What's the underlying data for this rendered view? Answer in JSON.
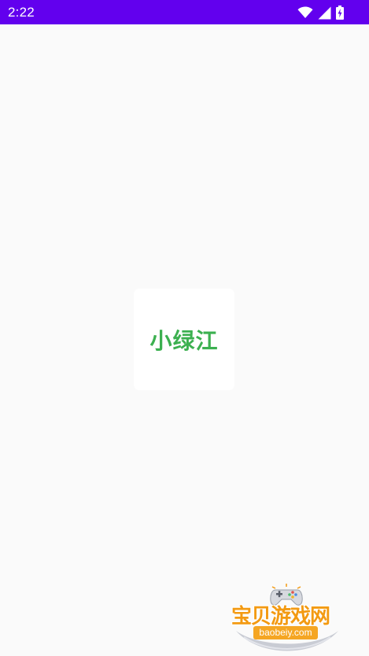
{
  "status_bar": {
    "time": "2:22",
    "background": "#6200ee",
    "icons": [
      "wifi-icon",
      "cellular-signal-icon",
      "battery-charging-icon"
    ]
  },
  "splash": {
    "logo_text": "小绿江",
    "logo_color": "#3cb050"
  },
  "watermark": {
    "title": "宝贝游戏网",
    "url": "baobeiy.com",
    "icon": "gamepad-icon"
  }
}
